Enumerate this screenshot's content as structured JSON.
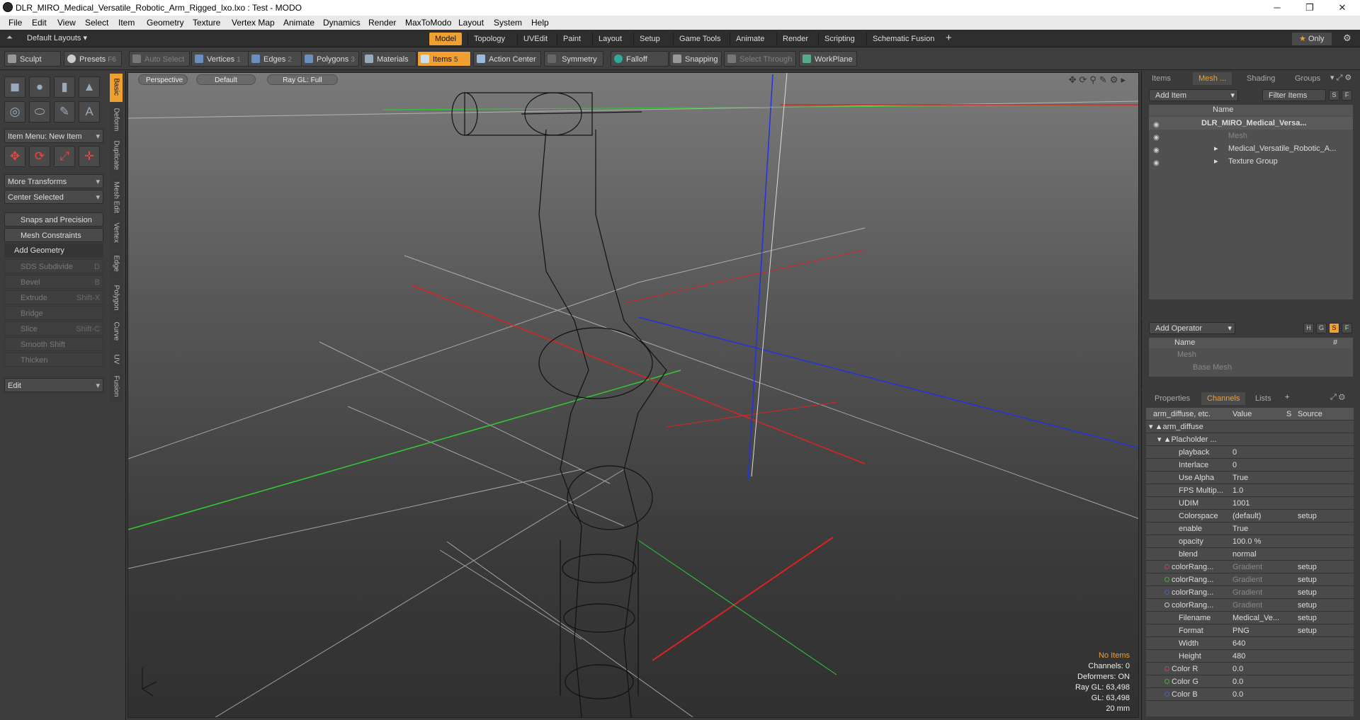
{
  "window": {
    "title": "DLR_MIRO_Medical_Versatile_Robotic_Arm_Rigged_lxo.lxo : Test - MODO",
    "minimize": "─",
    "maximize": "❐",
    "close": "✕"
  },
  "menu": [
    "File",
    "Edit",
    "View",
    "Select",
    "Item",
    "Geometry",
    "Texture",
    "Vertex Map",
    "Animate",
    "Dynamics",
    "Render",
    "MaxToModo",
    "Layout",
    "System",
    "Help"
  ],
  "layout": {
    "preset": "Default Layouts",
    "tabs": [
      "Model",
      "Topology",
      "UVEdit",
      "Paint",
      "Layout",
      "Setup",
      "Game Tools",
      "Animate",
      "Render",
      "Scripting",
      "Schematic Fusion"
    ],
    "active_tab": "Model",
    "add": "+",
    "only": "Only",
    "star": "★"
  },
  "toolbar": {
    "sculpt": "Sculpt",
    "presets": "Presets",
    "presets_key": "F6",
    "auto_select": "Auto Select",
    "vertices": "Vertices",
    "vertices_num": "1",
    "edges": "Edges",
    "edges_num": "2",
    "polygons": "Polygons",
    "polygons_num": "3",
    "materials": "Materials",
    "items": "Items",
    "items_num": "5",
    "action_center": "Action Center",
    "symmetry": "Symmetry",
    "falloff": "Falloff",
    "snapping": "Snapping",
    "select_through": "Select Through",
    "workplane": "WorkPlane"
  },
  "left_panel": {
    "item_menu": "Item Menu: New Item",
    "more_transforms": "More Transforms",
    "center_selected": "Center Selected",
    "snaps": "Snaps and Precision",
    "mesh_constraints": "Mesh Constraints",
    "add_geometry": "Add Geometry",
    "tools": [
      {
        "label": "SDS Subdivide",
        "key": "D"
      },
      {
        "label": "Bevel",
        "key": "B"
      },
      {
        "label": "Extrude",
        "key": "Shift-X"
      },
      {
        "label": "Bridge",
        "key": ""
      },
      {
        "label": "Slice",
        "key": "Shift-C"
      },
      {
        "label": "Smooth Shift",
        "key": ""
      },
      {
        "label": "Thicken",
        "key": ""
      }
    ],
    "edit": "Edit",
    "vtabs": [
      "Basic",
      "Deform",
      "Duplicate",
      "Mesh Edit",
      "Vertex",
      "Edge",
      "Polygon",
      "Curve",
      "UV",
      "Fusion"
    ]
  },
  "viewport": {
    "view": "Perspective",
    "shading": "Default",
    "render": "Ray GL: Full",
    "info": {
      "no_items": "No Items",
      "channels": "Channels: 0",
      "deformers": "Deformers: ON",
      "raygl": "Ray GL: 63,498",
      "gl": "GL: 63,498",
      "scale": "20 mm"
    }
  },
  "items_panel": {
    "tabs": [
      "Items",
      "Mesh ...",
      "Shading",
      "Groups"
    ],
    "active_tab": "Mesh ...",
    "add_item": "Add Item",
    "filter": "Filter Items",
    "s": "S",
    "f": "F",
    "col_name": "Name",
    "rows": [
      {
        "label": "DLR_MIRO_Medical_Versa...",
        "indent": 0,
        "bold": true
      },
      {
        "label": "Mesh",
        "indent": 1,
        "dim": true
      },
      {
        "label": "Medical_Versatile_Robotic_A...",
        "indent": 1
      },
      {
        "label": "Texture Group",
        "indent": 1
      }
    ]
  },
  "operator_panel": {
    "add_operator": "Add Operator",
    "h": "H",
    "g": "G",
    "s": "S",
    "f": "F",
    "col_name": "Name",
    "col_hash": "#",
    "rows": [
      "Mesh",
      "Base Mesh"
    ]
  },
  "channels_panel": {
    "tabs": [
      "Properties",
      "Channels",
      "Lists"
    ],
    "active_tab": "Channels",
    "add": "+",
    "header": {
      "name": "arm_diffuse, etc.",
      "value": "Value",
      "s": "S",
      "source": "Source"
    },
    "group": "arm_diffuse",
    "subgroup": "Placholder ...",
    "rows": [
      {
        "name": "playback",
        "value": "0",
        "source": ""
      },
      {
        "name": "Interlace",
        "value": "0",
        "source": ""
      },
      {
        "name": "Use Alpha",
        "value": "True",
        "source": ""
      },
      {
        "name": "FPS Multip...",
        "value": "1.0",
        "source": ""
      },
      {
        "name": "UDIM",
        "value": "1001",
        "source": ""
      },
      {
        "name": "Colorspace",
        "value": "(default)",
        "source": "setup"
      },
      {
        "name": "enable",
        "value": "True",
        "source": ""
      },
      {
        "name": "opacity",
        "value": "100.0 %",
        "source": ""
      },
      {
        "name": "blend",
        "value": "normal",
        "source": ""
      },
      {
        "name": "colorRang...",
        "value": "Gradient",
        "source": "setup",
        "dot": "#d04040"
      },
      {
        "name": "colorRang...",
        "value": "Gradient",
        "source": "setup",
        "dot": "#40b040"
      },
      {
        "name": "colorRang...",
        "value": "Gradient",
        "source": "setup",
        "dot": "#4060d0"
      },
      {
        "name": "colorRang...",
        "value": "Gradient",
        "source": "setup",
        "dot": "#cccccc"
      },
      {
        "name": "Filename",
        "value": "Medical_Ve...",
        "source": "setup"
      },
      {
        "name": "Format",
        "value": "PNG",
        "source": "setup"
      },
      {
        "name": "Width",
        "value": "640",
        "source": ""
      },
      {
        "name": "Height",
        "value": "480",
        "source": ""
      },
      {
        "name": "Color R",
        "value": "0.0",
        "source": "",
        "dot": "#d04040"
      },
      {
        "name": "Color G",
        "value": "0.0",
        "source": "",
        "dot": "#40b040"
      },
      {
        "name": "Color B",
        "value": "0.0",
        "source": "",
        "dot": "#4060d0"
      }
    ]
  },
  "colors": {
    "accent": "#f0a030",
    "bg": "#3a3a3a"
  }
}
